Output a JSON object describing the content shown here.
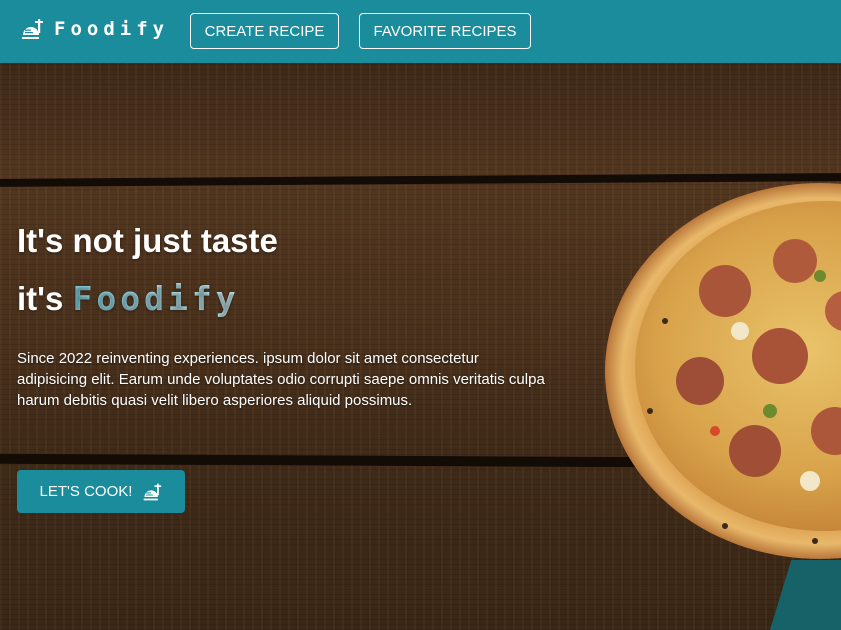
{
  "navbar": {
    "brand": "Foodify",
    "brand_icon": "food-tray-icon",
    "links": [
      {
        "label": "CREATE RECIPE"
      },
      {
        "label": "FAVORITE RECIPES"
      }
    ],
    "background": "#1a8c9c"
  },
  "hero": {
    "headline_line1": "It's not just taste",
    "headline_line2_prefix": "it's ",
    "headline_line2_accent": "Foodify",
    "description": "Since 2022 reinventing experiences. ipsum dolor sit amet consectetur adipisicing elit. Earum unde voluptates odio corrupti saepe omnis veritatis culpa harum debitis quasi velit libero asperiores aliquid possimus.",
    "cta_label": "LET'S COOK!",
    "cta_icon": "food-tray-icon",
    "image": "pizza-image",
    "accent_color": "#8ee4f4"
  }
}
